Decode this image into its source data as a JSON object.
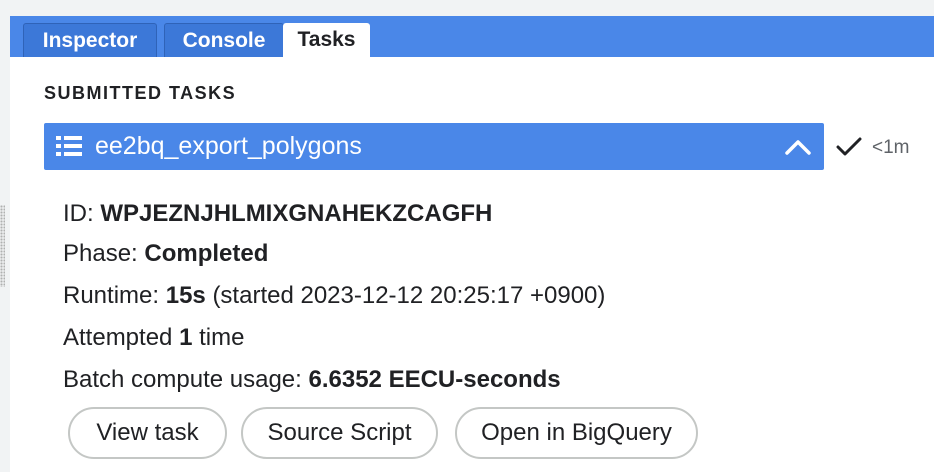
{
  "tabs": [
    {
      "label": "Inspector"
    },
    {
      "label": "Console"
    },
    {
      "label": "Tasks"
    }
  ],
  "section_title": "SUBMITTED TASKS",
  "task": {
    "name": "ee2bq_export_polygons",
    "status_icon": "check-icon",
    "duration": "<1m",
    "id_label": "ID:",
    "id_value": "WPJEZNJHLMIXGNAHEKZCAGFH",
    "phase_label": "Phase:",
    "phase_value": "Completed",
    "runtime_label": "Runtime:",
    "runtime_value": "15s",
    "runtime_started": "(started 2023-12-12 20:25:17 +0900)",
    "attempted_prefix": "Attempted",
    "attempted_count": "1",
    "attempted_suffix": "time",
    "batch_label": "Batch compute usage:",
    "batch_value": "6.6352 EECU-seconds"
  },
  "buttons": {
    "view_task": "View task",
    "source_script": "Source Script",
    "open_bigquery": "Open in BigQuery"
  },
  "colors": {
    "accent": "#4a87e8",
    "tab_inactive": "#3c78d8",
    "background": "#f1f3f4"
  }
}
